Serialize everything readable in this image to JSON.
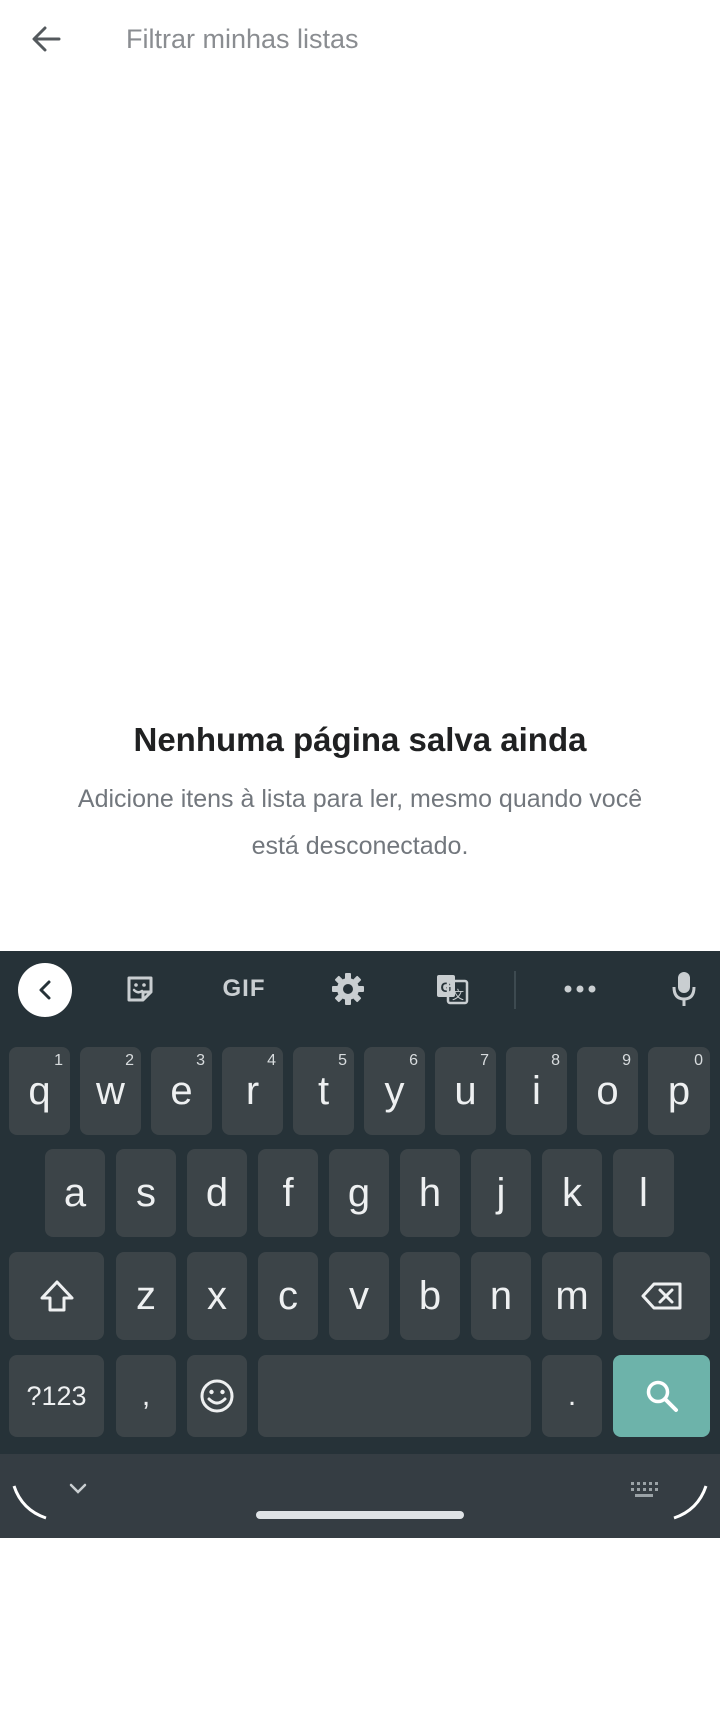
{
  "search": {
    "placeholder": "Filtrar minhas listas",
    "value": ""
  },
  "empty_state": {
    "title": "Nenhuma página salva ainda",
    "description": "Adicione itens à lista para ler, mesmo quando você está desconectado."
  },
  "keyboard": {
    "toolbar": {
      "gif_label": "GIF",
      "items": [
        "collapse-icon",
        "sticker-icon",
        "gif",
        "settings-icon",
        "translate-icon",
        "more-icon",
        "microphone-icon"
      ]
    },
    "row1": [
      {
        "key": "q",
        "hint": "1"
      },
      {
        "key": "w",
        "hint": "2"
      },
      {
        "key": "e",
        "hint": "3"
      },
      {
        "key": "r",
        "hint": "4"
      },
      {
        "key": "t",
        "hint": "5"
      },
      {
        "key": "y",
        "hint": "6"
      },
      {
        "key": "u",
        "hint": "7"
      },
      {
        "key": "i",
        "hint": "8"
      },
      {
        "key": "o",
        "hint": "9"
      },
      {
        "key": "p",
        "hint": "0"
      }
    ],
    "row2": [
      "a",
      "s",
      "d",
      "f",
      "g",
      "h",
      "j",
      "k",
      "l"
    ],
    "row3": [
      "z",
      "x",
      "c",
      "v",
      "b",
      "n",
      "m"
    ],
    "symbols_label": "?123",
    "comma": ",",
    "period": ".",
    "accent_color": "#6db3aa",
    "background_color": "#263238",
    "key_color": "#3c4448"
  }
}
